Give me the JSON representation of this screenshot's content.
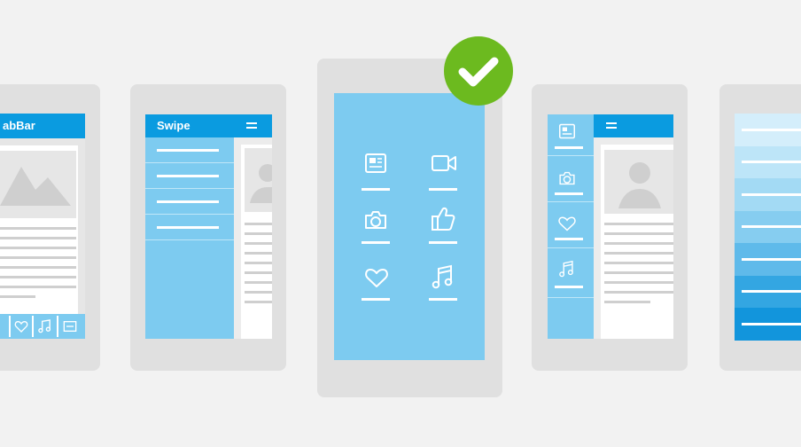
{
  "theme": {
    "background": "#f2f2f2",
    "card": "#e0e0e0",
    "header_blue": "#0a9be0",
    "panel_blue": "#7dcbf0",
    "light_blue": "#8fd3f4",
    "check_green": "#6cba1f"
  },
  "layouts": [
    {
      "id": "tabbar",
      "header_label": "abBar",
      "tab_icons": [
        "heart-icon",
        "music-note-icon",
        "card-icon"
      ]
    },
    {
      "id": "swipe",
      "header_label": "Swipe",
      "menu_items": 4
    },
    {
      "id": "dashboard",
      "selected": true,
      "icons": [
        "news-icon",
        "video-icon",
        "camera-icon",
        "thumbs-up-icon",
        "heart-icon",
        "music-note-icon"
      ]
    },
    {
      "id": "sidebar",
      "icons": [
        "news-icon",
        "camera-icon",
        "heart-icon",
        "music-note-icon"
      ]
    },
    {
      "id": "list",
      "rows": 7
    }
  ]
}
